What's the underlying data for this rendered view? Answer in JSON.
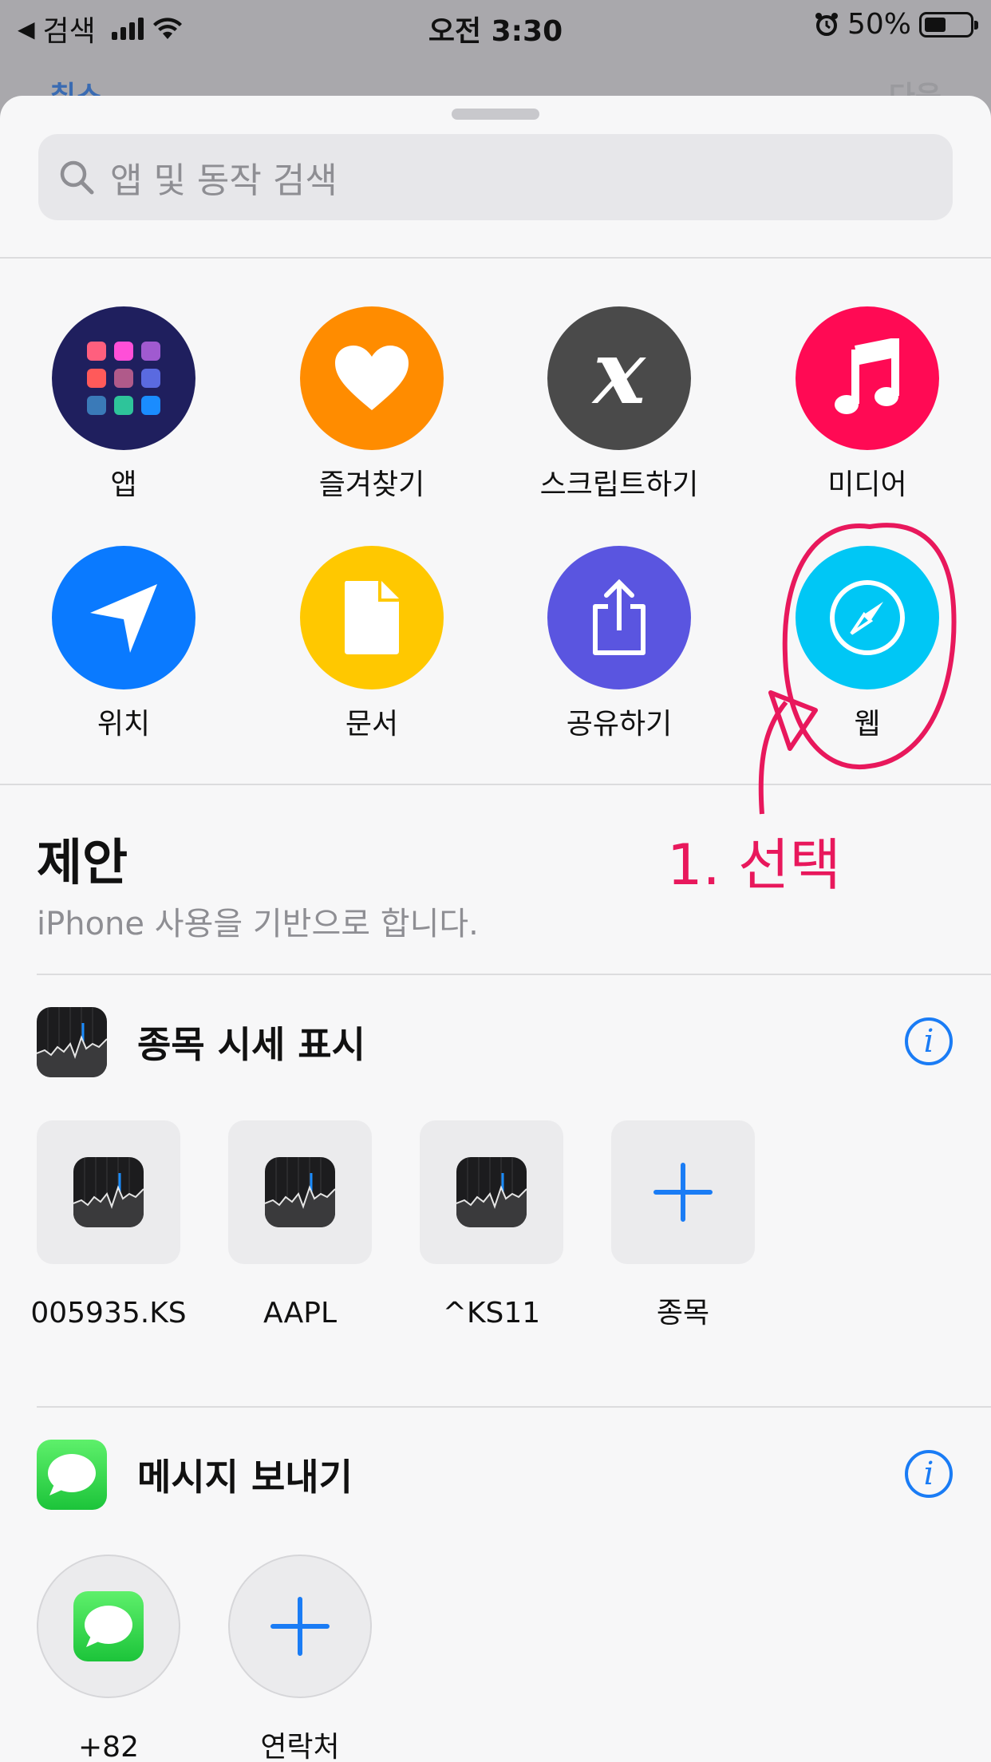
{
  "status_bar": {
    "back_label": "검색",
    "time": "오전 3:30",
    "battery": "50%"
  },
  "behind": {
    "cancel": "취소",
    "next": "다음"
  },
  "search": {
    "placeholder": "앱 및 동작 검색"
  },
  "categories": [
    {
      "label": "앱",
      "color": "#1f1f5e",
      "icon": "app-grid-icon"
    },
    {
      "label": "즐겨찾기",
      "color": "#ff8c00",
      "icon": "heart-icon"
    },
    {
      "label": "스크립트하기",
      "color": "#4a4a4a",
      "icon": "script-x-icon"
    },
    {
      "label": "미디어",
      "color": "#ff0a54",
      "icon": "music-note-icon"
    },
    {
      "label": "위치",
      "color": "#0a7aff",
      "icon": "location-arrow-icon"
    },
    {
      "label": "문서",
      "color": "#ffc800",
      "icon": "document-icon"
    },
    {
      "label": "공유하기",
      "color": "#5a55e0",
      "icon": "share-icon"
    },
    {
      "label": "웹",
      "color": "#00c7f5",
      "icon": "compass-icon"
    }
  ],
  "annotation": {
    "text": "1. 선택",
    "color": "#e8185c"
  },
  "suggestions": {
    "title": "제안",
    "subtitle": "iPhone 사용을 기반으로 합니다."
  },
  "stock_section": {
    "title": "종목 시세 표시",
    "items": [
      "005935.KS",
      "AAPL",
      "^KS11",
      "종목"
    ]
  },
  "message_section": {
    "title": "메시지 보내기",
    "items": [
      "+82",
      "연락처"
    ]
  }
}
